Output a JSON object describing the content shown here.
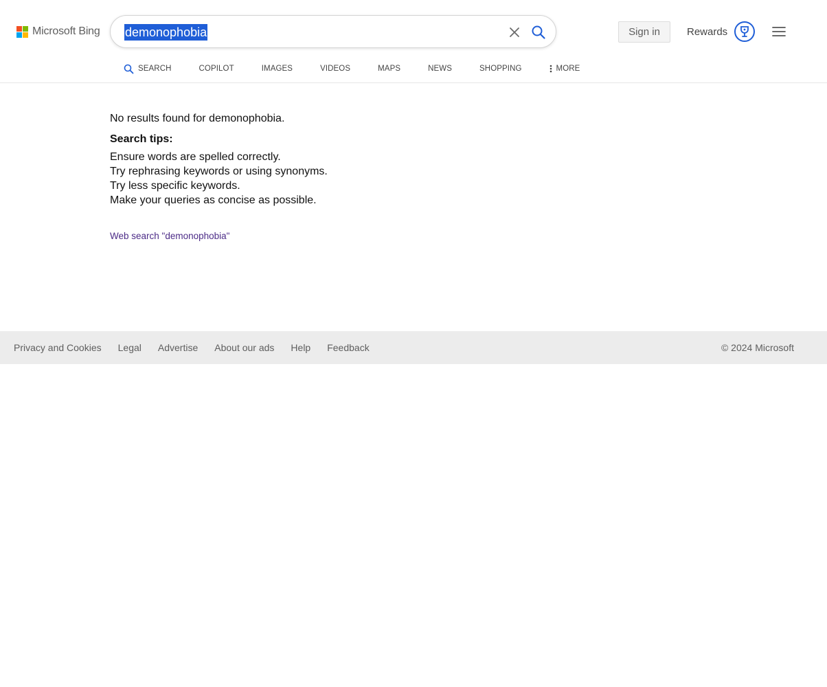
{
  "header": {
    "logo_text": "Microsoft Bing",
    "logo_colors": [
      "#f25022",
      "#7fba00",
      "#00a4ef",
      "#ffb900"
    ],
    "search": {
      "query": "demonophobia"
    },
    "sign_in_label": "Sign in",
    "rewards_label": "Rewards",
    "accent_color": "#1f5ed7"
  },
  "tabs": [
    {
      "label": "SEARCH",
      "icon": "search-icon"
    },
    {
      "label": "COPILOT"
    },
    {
      "label": "IMAGES"
    },
    {
      "label": "VIDEOS"
    },
    {
      "label": "MAPS"
    },
    {
      "label": "NEWS"
    },
    {
      "label": "SHOPPING"
    },
    {
      "label": "MORE",
      "icon": "more-vertical-icon"
    }
  ],
  "main": {
    "no_results": "No results found for demonophobia.",
    "tips_heading": "Search tips:",
    "tips": [
      "Ensure words are spelled correctly.",
      "Try rephrasing keywords or using synonyms.",
      "Try less specific keywords.",
      "Make your queries as concise as possible."
    ],
    "web_search_link": "Web search \"demonophobia\""
  },
  "footer": {
    "links": [
      "Privacy and Cookies",
      "Legal",
      "Advertise",
      "About our ads",
      "Help",
      "Feedback"
    ],
    "copyright": "© 2024 Microsoft"
  }
}
